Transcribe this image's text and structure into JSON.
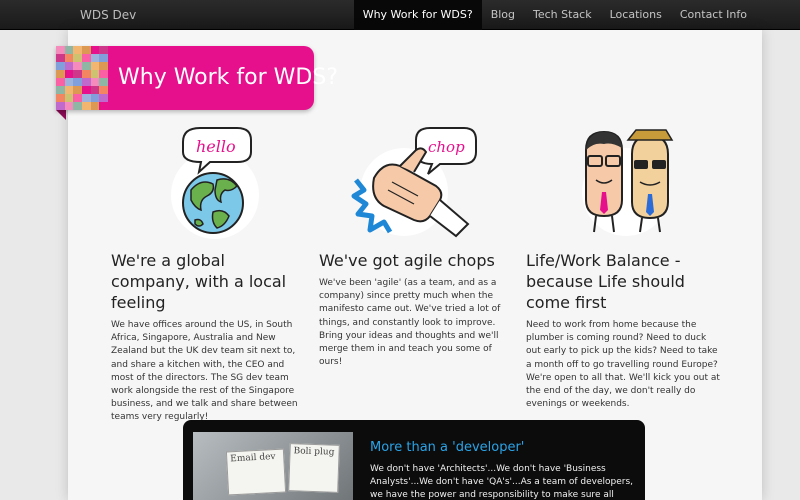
{
  "navbar": {
    "brand": "WDS Dev",
    "items": [
      {
        "label": "Why Work for WDS?",
        "active": true
      },
      {
        "label": "Blog",
        "active": false
      },
      {
        "label": "Tech Stack",
        "active": false
      },
      {
        "label": "Locations",
        "active": false
      },
      {
        "label": "Contact Info",
        "active": false
      }
    ]
  },
  "ribbon": {
    "title": "Why Work for WDS?",
    "color": "#e6108d"
  },
  "columns": [
    {
      "illustration": "globe-speech-bubble-icon",
      "bubble_text": "hello",
      "heading": "We're a global company, with a local feeling",
      "body": "We have offices around the US, in South Africa, Singapore, Australia and New Zealand but the UK dev team sit next to, and share a kitchen with, the CEO and most of the directors. The SG dev team work alongside the rest of the Singapore business, and we talk and share between teams very regularly!"
    },
    {
      "illustration": "karate-chop-hand-icon",
      "bubble_text": "chop",
      "heading": "We've got agile chops",
      "body": "We've been 'agile' (as a team, and as a company) since pretty much when the manifesto came out. We've tried a lot of things, and constantly look to improve. Bring your ideas and thoughts and we'll merge them in and teach you some of ours!"
    },
    {
      "illustration": "two-cartoon-developers-icon",
      "heading": "Life/Work Balance - because Life should come first",
      "body": "Need to work from home because the plumber is coming round? Need to duck out early to pick up the kids? Need to take a month off to go travelling round Europe? We're open to all that. We'll kick you out at the end of the day, we don't really do evenings or weekends."
    }
  ],
  "developer_panel": {
    "title": "More than a 'developer'",
    "body": "We don't have 'Architects'...We don't have 'Business Analysts'...We don't have 'QA's'...As a team of developers, we have the power and responsibility to make sure all those things happen...",
    "photo_cards": [
      "Email dev",
      "Boli plug"
    ],
    "title_color": "#2aa3e8"
  }
}
